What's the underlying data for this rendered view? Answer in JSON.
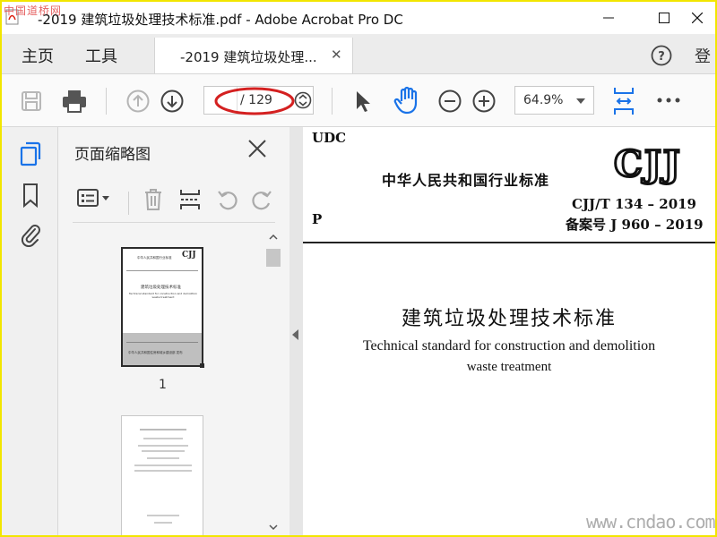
{
  "window": {
    "title": "-2019 建筑垃圾处理技术标准.pdf - Adobe Acrobat Pro DC",
    "watermark_top": "中国道桥网",
    "watermark_bottom": "www.cndao.com"
  },
  "menubar": {
    "home_label": "主页",
    "tools_label": "工具",
    "tab_label": "-2019 建筑垃圾处理...",
    "signin_label": "登"
  },
  "toolbar": {
    "current_page": "",
    "page_total": "/ 129",
    "zoom": "64.9%"
  },
  "thumbnails": {
    "title": "页面缩略图",
    "page1_number": "1",
    "thumb1_header": "中华人民共和国行业标准",
    "thumb1_logo": "CJJ",
    "thumb1_title": "建筑垃圾处理技术标准",
    "thumb1_en": "Technical standard for construction and demolition waste treatment",
    "thumb1_footer": "中华人民共和国住房和城乡建设部 发布"
  },
  "document": {
    "udc": "UDC",
    "standard": "中华人民共和国行业标准",
    "logo": "CJJ",
    "code": "CJJ/T 134 – 2019",
    "record": "备案号 J 960 – 2019",
    "p": "P",
    "title_cn": "建筑垃圾处理技术标准",
    "title_en_line1": "Technical standard for construction and demolition",
    "title_en_line2": "waste treatment"
  },
  "colors": {
    "accent": "#1a73e8",
    "frame": "#f2e600",
    "annotation": "#d42020"
  }
}
